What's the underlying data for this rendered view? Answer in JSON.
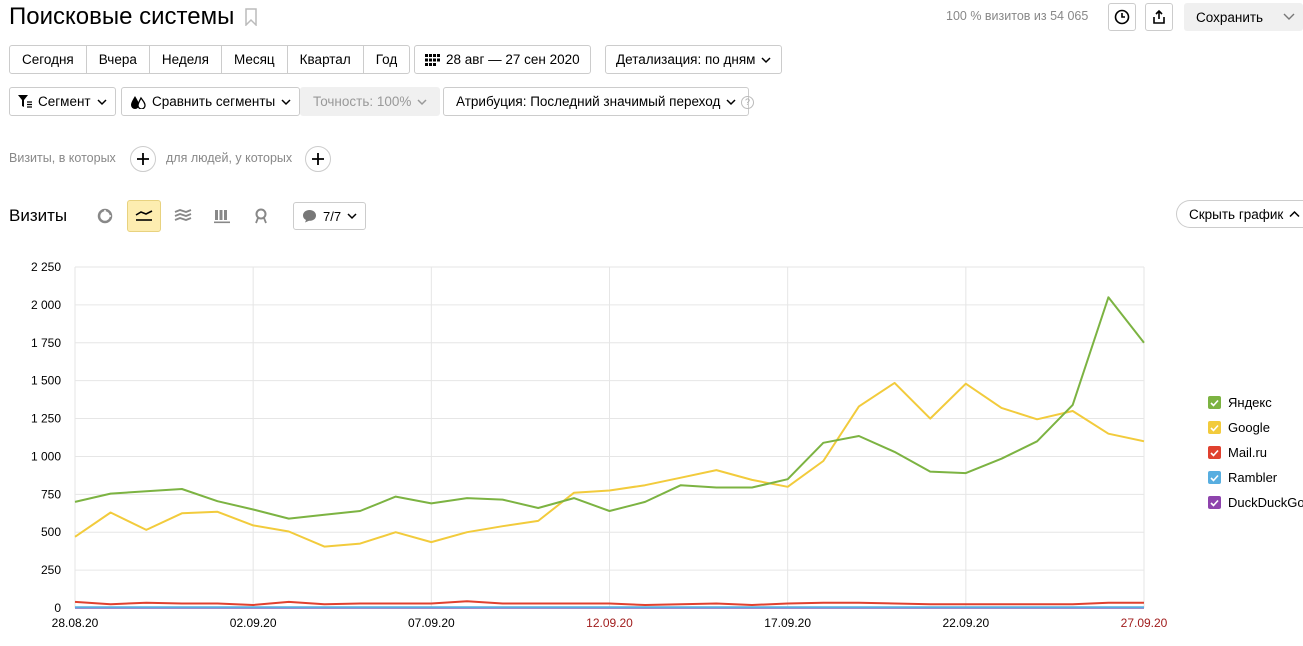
{
  "header": {
    "title": "Поисковые системы",
    "visits_share": "100 % визитов из 54 065",
    "save_label": "Сохранить"
  },
  "periods": [
    "Сегодня",
    "Вчера",
    "Неделя",
    "Месяц",
    "Квартал",
    "Год"
  ],
  "date_range": "28 авг — 27 сен 2020",
  "detail": "Детализация: по дням",
  "toolbar": {
    "segment": "Сегмент",
    "compare": "Сравнить сегменты",
    "accuracy": "Точность: 100%",
    "attribution": "Атрибуция: Последний значимый переход",
    "help": "?"
  },
  "filters": {
    "visits_label": "Визиты, в которых",
    "people_label": "для людей, у которых"
  },
  "chart_header": {
    "title": "Визиты",
    "counter": "7/7",
    "hide_chart": "Скрыть график"
  },
  "colors": {
    "yandex": "#7cb342",
    "google": "#f2cb3c",
    "mailru": "#e0412f",
    "rambler": "#58aee0",
    "duckduckgo": "#8e44ad"
  },
  "chart_data": {
    "type": "line",
    "x": [
      "28.08.20",
      "29.08.20",
      "30.08.20",
      "31.08.20",
      "01.09.20",
      "02.09.20",
      "03.09.20",
      "04.09.20",
      "05.09.20",
      "06.09.20",
      "07.09.20",
      "08.09.20",
      "09.09.20",
      "10.09.20",
      "11.09.20",
      "12.09.20",
      "13.09.20",
      "14.09.20",
      "15.09.20",
      "16.09.20",
      "17.09.20",
      "18.09.20",
      "19.09.20",
      "20.09.20",
      "21.09.20",
      "22.09.20",
      "23.09.20",
      "24.09.20",
      "25.09.20",
      "26.09.20",
      "27.09.20"
    ],
    "xticks": [
      {
        "label": "28.08.20",
        "index": 0,
        "weekend": false
      },
      {
        "label": "02.09.20",
        "index": 5,
        "weekend": false
      },
      {
        "label": "07.09.20",
        "index": 10,
        "weekend": false
      },
      {
        "label": "12.09.20",
        "index": 15,
        "weekend": true
      },
      {
        "label": "17.09.20",
        "index": 20,
        "weekend": false
      },
      {
        "label": "22.09.20",
        "index": 25,
        "weekend": false
      },
      {
        "label": "27.09.20",
        "index": 30,
        "weekend": true
      }
    ],
    "yticks": [
      {
        "value": 0,
        "label": "0"
      },
      {
        "value": 250,
        "label": "250"
      },
      {
        "value": 500,
        "label": "500"
      },
      {
        "value": 750,
        "label": "750"
      },
      {
        "value": 1000,
        "label": "1 000"
      },
      {
        "value": 1250,
        "label": "1 250"
      },
      {
        "value": 1500,
        "label": "1 500"
      },
      {
        "value": 1750,
        "label": "1 750"
      },
      {
        "value": 2000,
        "label": "2 000"
      },
      {
        "value": 2250,
        "label": "2 250"
      }
    ],
    "ylim": [
      0,
      2250
    ],
    "series": [
      {
        "name": "Яндекс",
        "color": "#7cb342",
        "values": [
          700,
          755,
          770,
          785,
          705,
          650,
          590,
          615,
          640,
          735,
          690,
          725,
          715,
          660,
          725,
          640,
          700,
          810,
          795,
          795,
          850,
          1090,
          1135,
          1030,
          900,
          890,
          985,
          1100,
          1340,
          2050,
          1750
        ]
      },
      {
        "name": "Google",
        "color": "#f2cb3c",
        "values": [
          470,
          630,
          515,
          625,
          635,
          545,
          505,
          405,
          425,
          500,
          435,
          500,
          540,
          575,
          760,
          775,
          810,
          860,
          910,
          845,
          800,
          970,
          1330,
          1485,
          1250,
          1480,
          1320,
          1245,
          1300,
          1150,
          1100
        ]
      },
      {
        "name": "Mail.ru",
        "color": "#e0412f",
        "values": [
          40,
          25,
          35,
          30,
          30,
          20,
          40,
          25,
          30,
          30,
          30,
          45,
          30,
          30,
          30,
          30,
          20,
          25,
          30,
          20,
          30,
          35,
          35,
          30,
          25,
          25,
          25,
          25,
          25,
          35,
          35
        ]
      },
      {
        "name": "Rambler",
        "color": "#58aee0",
        "values": [
          5,
          5,
          5,
          5,
          5,
          5,
          5,
          5,
          5,
          5,
          5,
          5,
          5,
          5,
          5,
          5,
          5,
          5,
          5,
          5,
          5,
          5,
          5,
          5,
          5,
          5,
          5,
          5,
          5,
          5,
          5
        ]
      },
      {
        "name": "DuckDuckGo",
        "color": "#8e44ad",
        "values": [
          2,
          2,
          2,
          2,
          2,
          2,
          2,
          2,
          2,
          2,
          2,
          2,
          2,
          2,
          2,
          2,
          2,
          2,
          2,
          2,
          2,
          2,
          2,
          2,
          2,
          2,
          2,
          2,
          2,
          2,
          2
        ]
      }
    ],
    "legend": [
      "Яндекс",
      "Google",
      "Mail.ru",
      "Rambler",
      "DuckDuckGo"
    ],
    "legend_position": "right",
    "grid": true
  }
}
